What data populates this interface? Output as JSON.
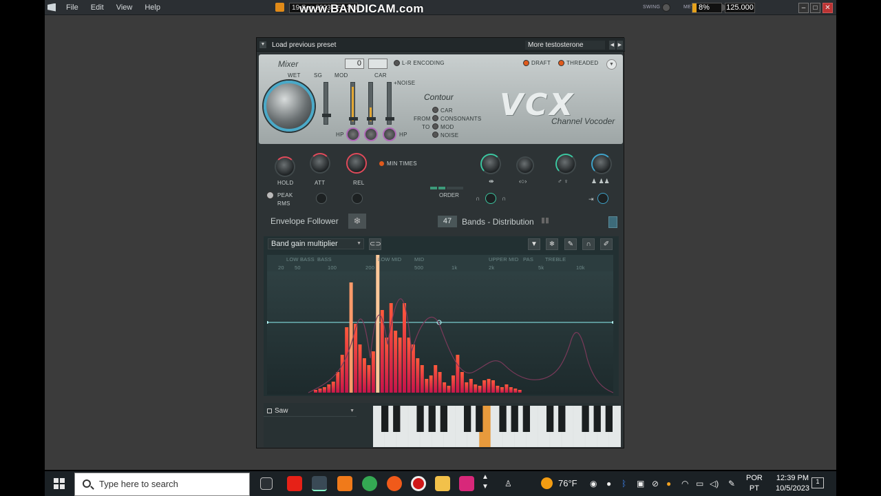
{
  "topbar": {
    "menus": [
      "File",
      "Edit",
      "View",
      "Help"
    ],
    "hint": "19 Sep 2023 - FL Studio",
    "watermark": "www.BANDICAM.com",
    "swing_label": "SWING",
    "metronome_label": "METRONOME",
    "cpu": "8%",
    "tempo": "125.000",
    "window_buttons": [
      "–",
      "□",
      "✕"
    ]
  },
  "plugin": {
    "preset_left": "Load previous preset",
    "preset_right": "More testosterone",
    "header": {
      "mixer": "Mixer",
      "wet": "WET",
      "sg": "SG",
      "mod": "MOD",
      "car": "CAR",
      "noise": "+NOISE",
      "hp_left": "HP",
      "hp_right": "HP",
      "value": "0",
      "lr": "L-R ENCODING",
      "draft": "DRAFT",
      "threaded": "THREADED",
      "contour": "Contour",
      "from": "FROM",
      "to": "TO",
      "options": [
        "CAR",
        "CONSONANTS",
        "MOD",
        "NOISE"
      ],
      "logo": "VCX",
      "subtitle": "Channel Vocoder"
    },
    "env": {
      "hold": "HOLD",
      "att": "ATT",
      "rel": "REL",
      "min_times": "MIN TIMES",
      "peak": "PEAK",
      "rms": "RMS",
      "order": "ORDER",
      "label": "Envelope Follower"
    },
    "bands": {
      "count": "47",
      "label": "Bands - Distribution",
      "multiplier": "Band gain multiplier",
      "ranges": [
        "LOW BASS",
        "BASS",
        "LOW MID",
        "MID",
        "UPPER MID",
        "PAS",
        "TREBLE"
      ],
      "freqs": [
        "20",
        "50",
        "100",
        "200",
        "500",
        "1k",
        "2k",
        "5k",
        "10k"
      ],
      "heights": [
        4,
        6,
        8,
        12,
        16,
        30,
        55,
        95,
        160,
        100,
        70,
        50,
        40,
        60,
        200,
        120,
        80,
        130,
        90,
        80,
        130,
        80,
        70,
        50,
        40,
        20,
        25,
        40,
        30,
        15,
        10,
        25,
        55,
        30,
        15,
        20,
        12,
        10,
        18,
        20,
        18,
        10,
        8,
        12,
        8,
        6,
        4
      ]
    },
    "piano": {
      "instrument": "Saw"
    }
  },
  "taskbar": {
    "search": "Type here to search",
    "weather": "76°F",
    "lang": [
      "POR",
      "PT"
    ],
    "time": "12:39 PM",
    "date": "10/5/2023",
    "notif": "1"
  }
}
